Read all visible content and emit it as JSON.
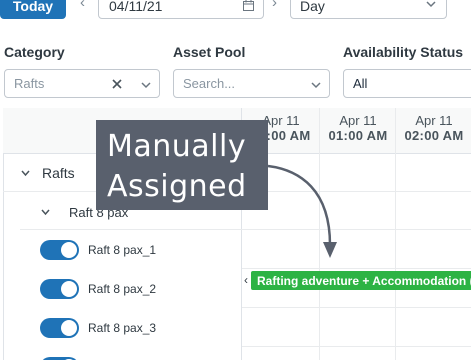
{
  "toolbar": {
    "today_label": "Today",
    "prev_icon": "‹",
    "next_icon": "›",
    "date_value": "04/11/21",
    "view_value": "Day"
  },
  "filters": {
    "category": {
      "label": "Category",
      "value": "Rafts"
    },
    "asset_pool": {
      "label": "Asset Pool",
      "placeholder": "Search..."
    },
    "availability": {
      "label": "Availability Status",
      "value": "All"
    }
  },
  "timeline": {
    "hours": [
      {
        "date": "Apr 11",
        "time": "12:00 AM"
      },
      {
        "date": "Apr 11",
        "time": "01:00 AM"
      },
      {
        "date": "Apr 11",
        "time": "02:00 AM"
      }
    ]
  },
  "tree": {
    "group": "Rafts",
    "subgroup": "Raft 8 pax",
    "items": [
      {
        "label": "Raft 8 pax_1",
        "enabled": true
      },
      {
        "label": "Raft 8 pax_2",
        "enabled": true
      },
      {
        "label": "Raft 8 pax_3",
        "enabled": true
      }
    ]
  },
  "booking": {
    "label": "Rafting adventure + Accommodation (S",
    "color": "#2db344"
  },
  "annotation": {
    "line1": "Manually",
    "line2": "Assigned"
  },
  "colors": {
    "accent": "#1f73b7",
    "booking": "#2db344",
    "callout": "#59606d"
  }
}
